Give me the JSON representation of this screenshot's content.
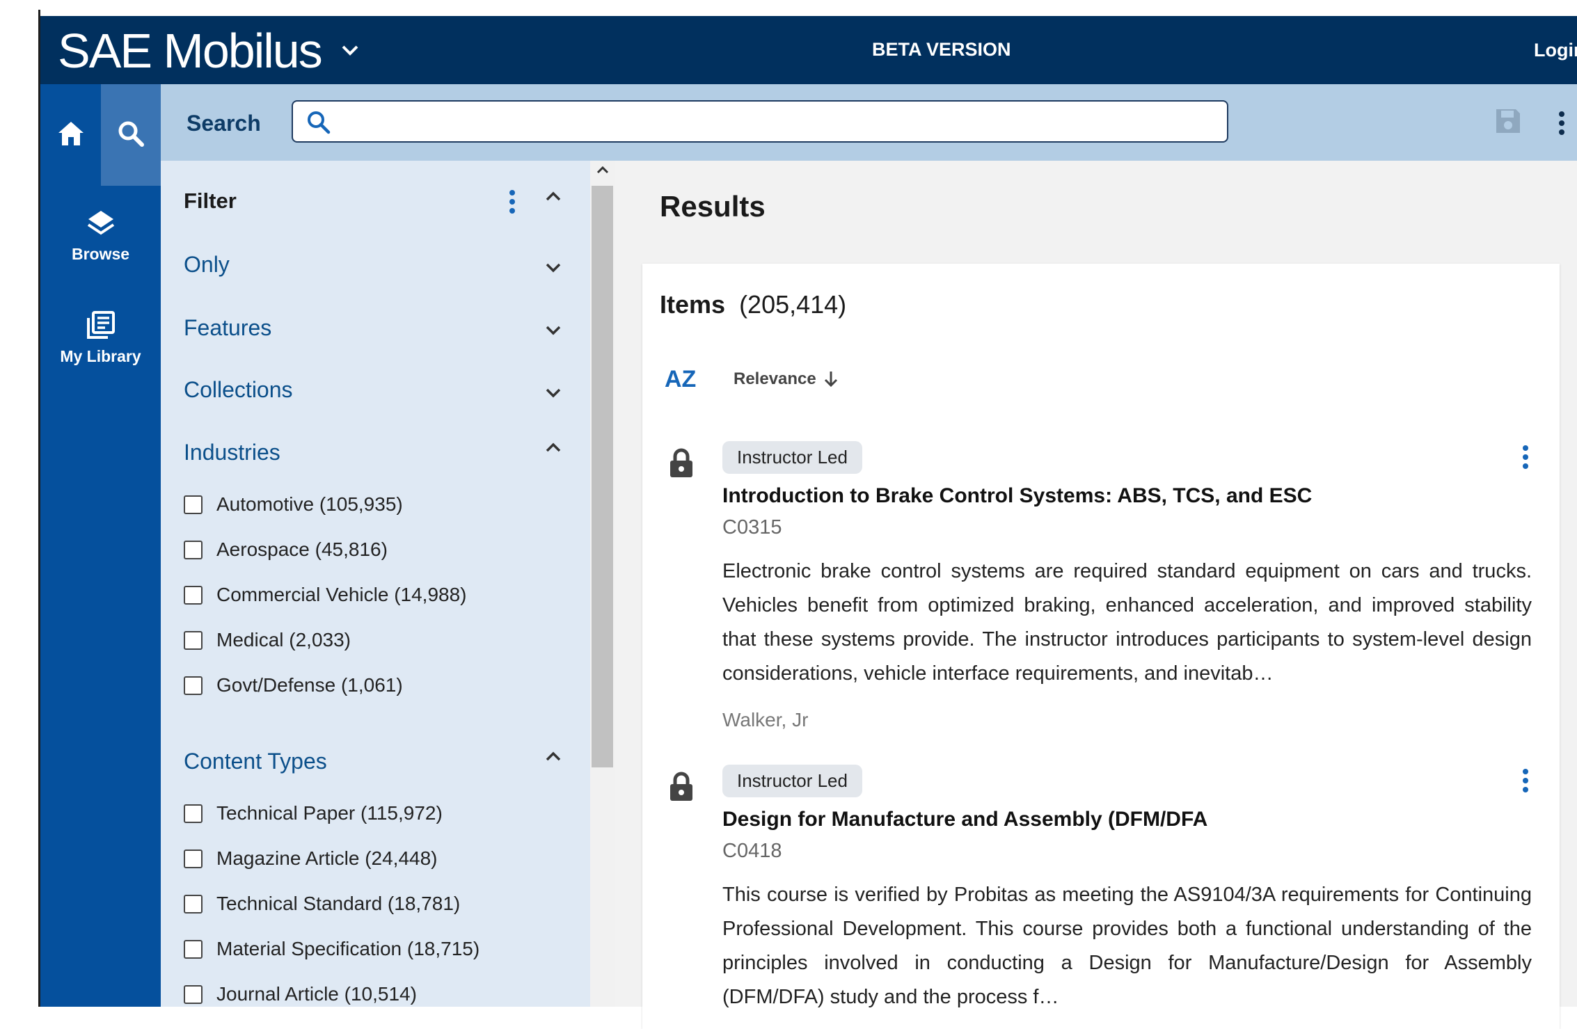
{
  "header": {
    "brand": "SAE Mobilus",
    "beta": "BETA VERSION",
    "login": "Login"
  },
  "nav": {
    "browse": "Browse",
    "library": "My Library"
  },
  "search": {
    "label": "Search",
    "value": "",
    "placeholder": ""
  },
  "filter": {
    "title": "Filter",
    "only": "Only",
    "features": "Features",
    "collections": "Collections",
    "industries": {
      "title": "Industries",
      "options": [
        "Automotive (105,935)",
        "Aerospace (45,816)",
        "Commercial Vehicle (14,988)",
        "Medical (2,033)",
        "Govt/Defense (1,061)"
      ]
    },
    "content_types": {
      "title": "Content Types",
      "options": [
        "Technical Paper (115,972)",
        "Magazine Article (24,448)",
        "Technical Standard (18,781)",
        "Material Specification (18,715)",
        "Journal Article (10,514)"
      ]
    }
  },
  "results": {
    "title": "Results",
    "items_label": "Items",
    "items_count": "(205,414)",
    "sort_az": "AZ",
    "sort_label": "Relevance",
    "list": [
      {
        "badge": "Instructor Led",
        "title": "Introduction to Brake Control Systems: ABS, TCS, and ESC",
        "code": "C0315",
        "description": "Electronic brake control systems are required standard equipment on cars and trucks. Vehicles benefit from optimized braking, enhanced acceleration, and improved stability that these systems provide. The instructor introduces participants to system-level design considerations, vehicle interface requirements, and inevitab…",
        "author": "Walker, Jr"
      },
      {
        "badge": "Instructor Led",
        "title": "Design for Manufacture and Assembly (DFM/DFA",
        "code": "C0418",
        "description": "This course is verified by Probitas as meeting the AS9104/3A requirements for Continuing Professional Development. This course provides both a functional understanding of the principles involved in conducting a Design for Manufacture/Design for Assembly (DFM/DFA) study and the process f…",
        "author": ""
      }
    ]
  },
  "colors": {
    "header": "#01305e",
    "nav": "#05509d",
    "nav_active": "#3a74b3",
    "search_row": "#b3cde4",
    "filter_bg": "#dfe9f4",
    "accent": "#0b4f8a"
  },
  "icons": [
    "chevron-down-icon",
    "home-icon",
    "search-icon",
    "layers-icon",
    "library-icon",
    "save-icon",
    "more-vertical-icon",
    "chevron-up-icon",
    "lock-icon",
    "arrow-down-icon"
  ]
}
